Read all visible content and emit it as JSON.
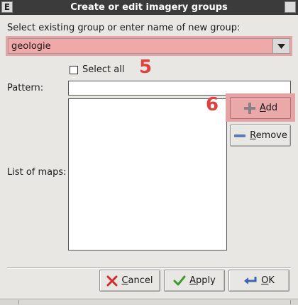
{
  "window": {
    "title": "Create or edit imagery groups",
    "icon_letter": "E"
  },
  "group": {
    "prompt": "Select existing group or enter name of new group:",
    "value": "geologie"
  },
  "select_all": {
    "label": "Select all",
    "checked": false
  },
  "pattern": {
    "label": "Pattern:",
    "value": ""
  },
  "maps": {
    "label": "List of maps:",
    "items": []
  },
  "buttons": {
    "add": {
      "key": "A",
      "rest": "dd"
    },
    "remove": {
      "key": "R",
      "rest": "emove"
    },
    "cancel": {
      "key": "C",
      "rest": "ancel"
    },
    "apply": {
      "key": "A",
      "rest": "pply"
    },
    "ok": {
      "key": "O",
      "rest": "K"
    }
  },
  "annotations": {
    "marker_5": "5",
    "marker_6": "6"
  },
  "colors": {
    "highlight": "#e6a3a5",
    "marker": "#e04040"
  }
}
